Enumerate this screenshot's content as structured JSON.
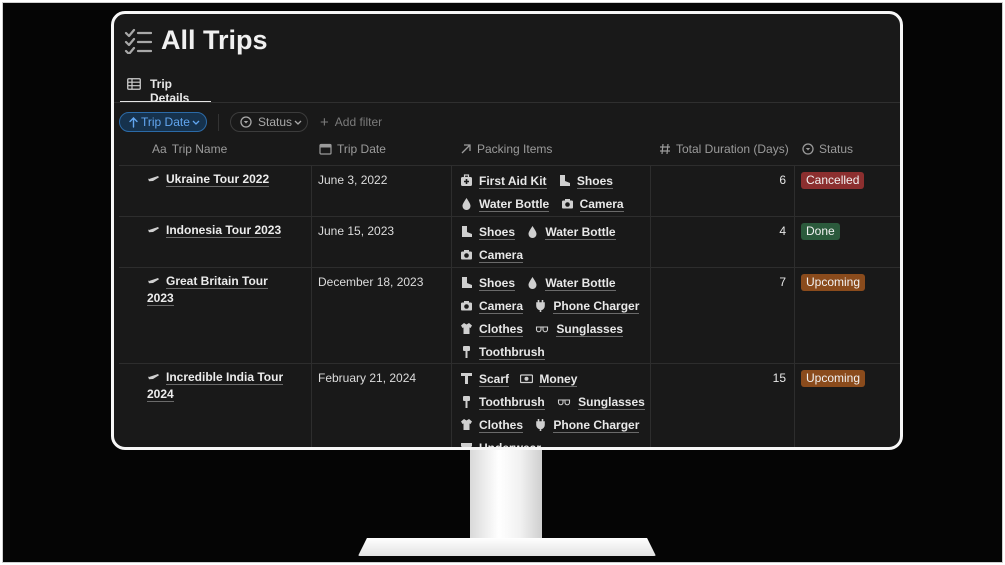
{
  "page": {
    "title": "All Trips"
  },
  "tabs": [
    {
      "label": "Trip Details"
    }
  ],
  "filters": {
    "sort_label": "Trip Date",
    "status_label": "Status",
    "add_filter_label": "Add filter"
  },
  "columns": [
    {
      "label": "Trip Name",
      "icon": "text-aa-icon"
    },
    {
      "label": "Trip Date",
      "icon": "calendar-icon"
    },
    {
      "label": "Packing Items",
      "icon": "arrow-up-right-icon"
    },
    {
      "label": "Total Duration (Days)",
      "icon": "hash-icon"
    },
    {
      "label": "Status",
      "icon": "status-circle-icon"
    }
  ],
  "rows": [
    {
      "name": "Ukraine Tour 2022",
      "date": "June 3, 2022",
      "items": [
        "First Aid Kit",
        "Shoes",
        "Water Bottle",
        "Camera"
      ],
      "duration": "6",
      "status": "Cancelled",
      "status_color": "#8c2f2f"
    },
    {
      "name": "Indonesia Tour 2023",
      "date": "June 15, 2023",
      "items": [
        "Shoes",
        "Water Bottle",
        "Camera"
      ],
      "duration": "4",
      "status": "Done",
      "status_color": "#2b5a3c"
    },
    {
      "name": "Great Britain Tour 2023",
      "date": "December 18, 2023",
      "items": [
        "Shoes",
        "Water Bottle",
        "Camera",
        "Phone Charger",
        "Clothes",
        "Sunglasses",
        "Toothbrush"
      ],
      "duration": "7",
      "status": "Upcoming",
      "status_color": "#8a4b1c"
    },
    {
      "name": "Incredible India Tour 2024",
      "date": "February 21, 2024",
      "items": [
        "Scarf",
        "Money",
        "Toothbrush",
        "Sunglasses",
        "Clothes",
        "Phone Charger",
        "Underwear"
      ],
      "duration": "15",
      "status": "Upcoming",
      "status_color": "#8a4b1c"
    }
  ],
  "colors": {
    "background": "#191919",
    "accent": "#2b6aa7",
    "cancelled": "#8c2f2f",
    "done": "#2b5a3c",
    "upcoming": "#8a4b1c"
  }
}
